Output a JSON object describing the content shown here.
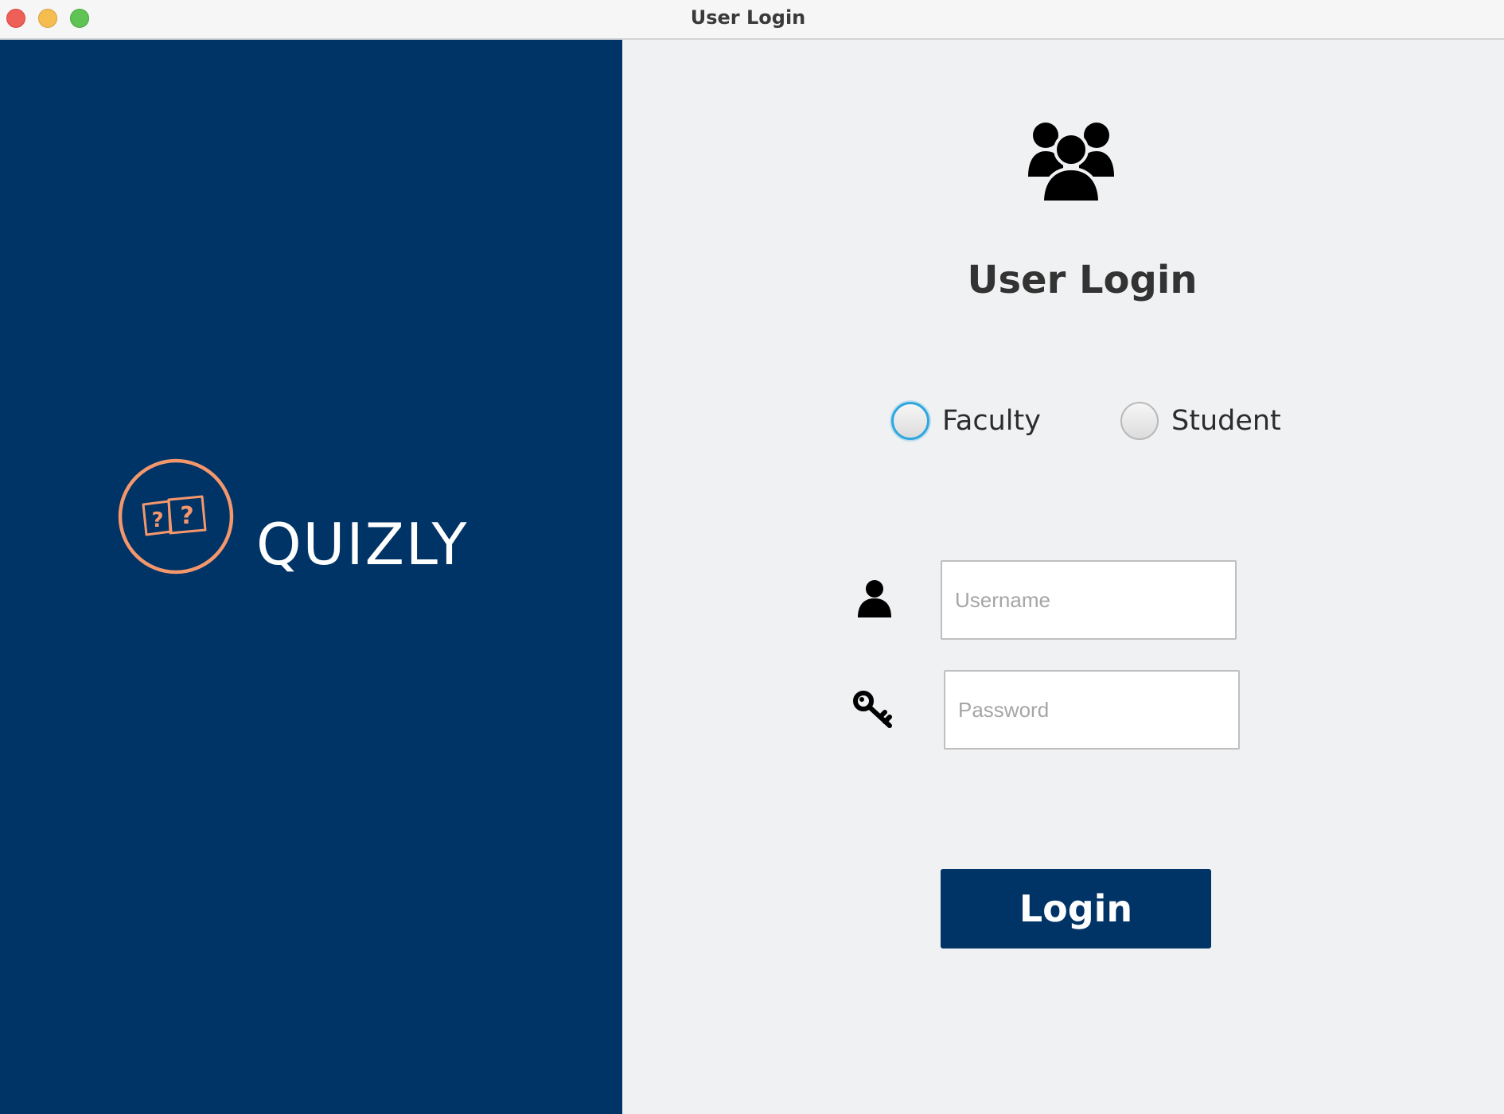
{
  "window": {
    "title": "User Login"
  },
  "brand": {
    "name": "QUIZLY",
    "logo_icon": "question-cards-logo",
    "accent_color": "#f4976c",
    "panel_color": "#003366"
  },
  "login": {
    "header_icon": "users-icon",
    "heading": "User Login",
    "roles": [
      {
        "label": "Faculty",
        "selected": false,
        "focused": true
      },
      {
        "label": "Student",
        "selected": false,
        "focused": false
      }
    ],
    "username": {
      "icon": "user-icon",
      "value": "",
      "placeholder": "Username"
    },
    "password": {
      "icon": "key-icon",
      "value": "",
      "placeholder": "Password"
    },
    "submit_label": "Login",
    "button_color": "#003366"
  }
}
